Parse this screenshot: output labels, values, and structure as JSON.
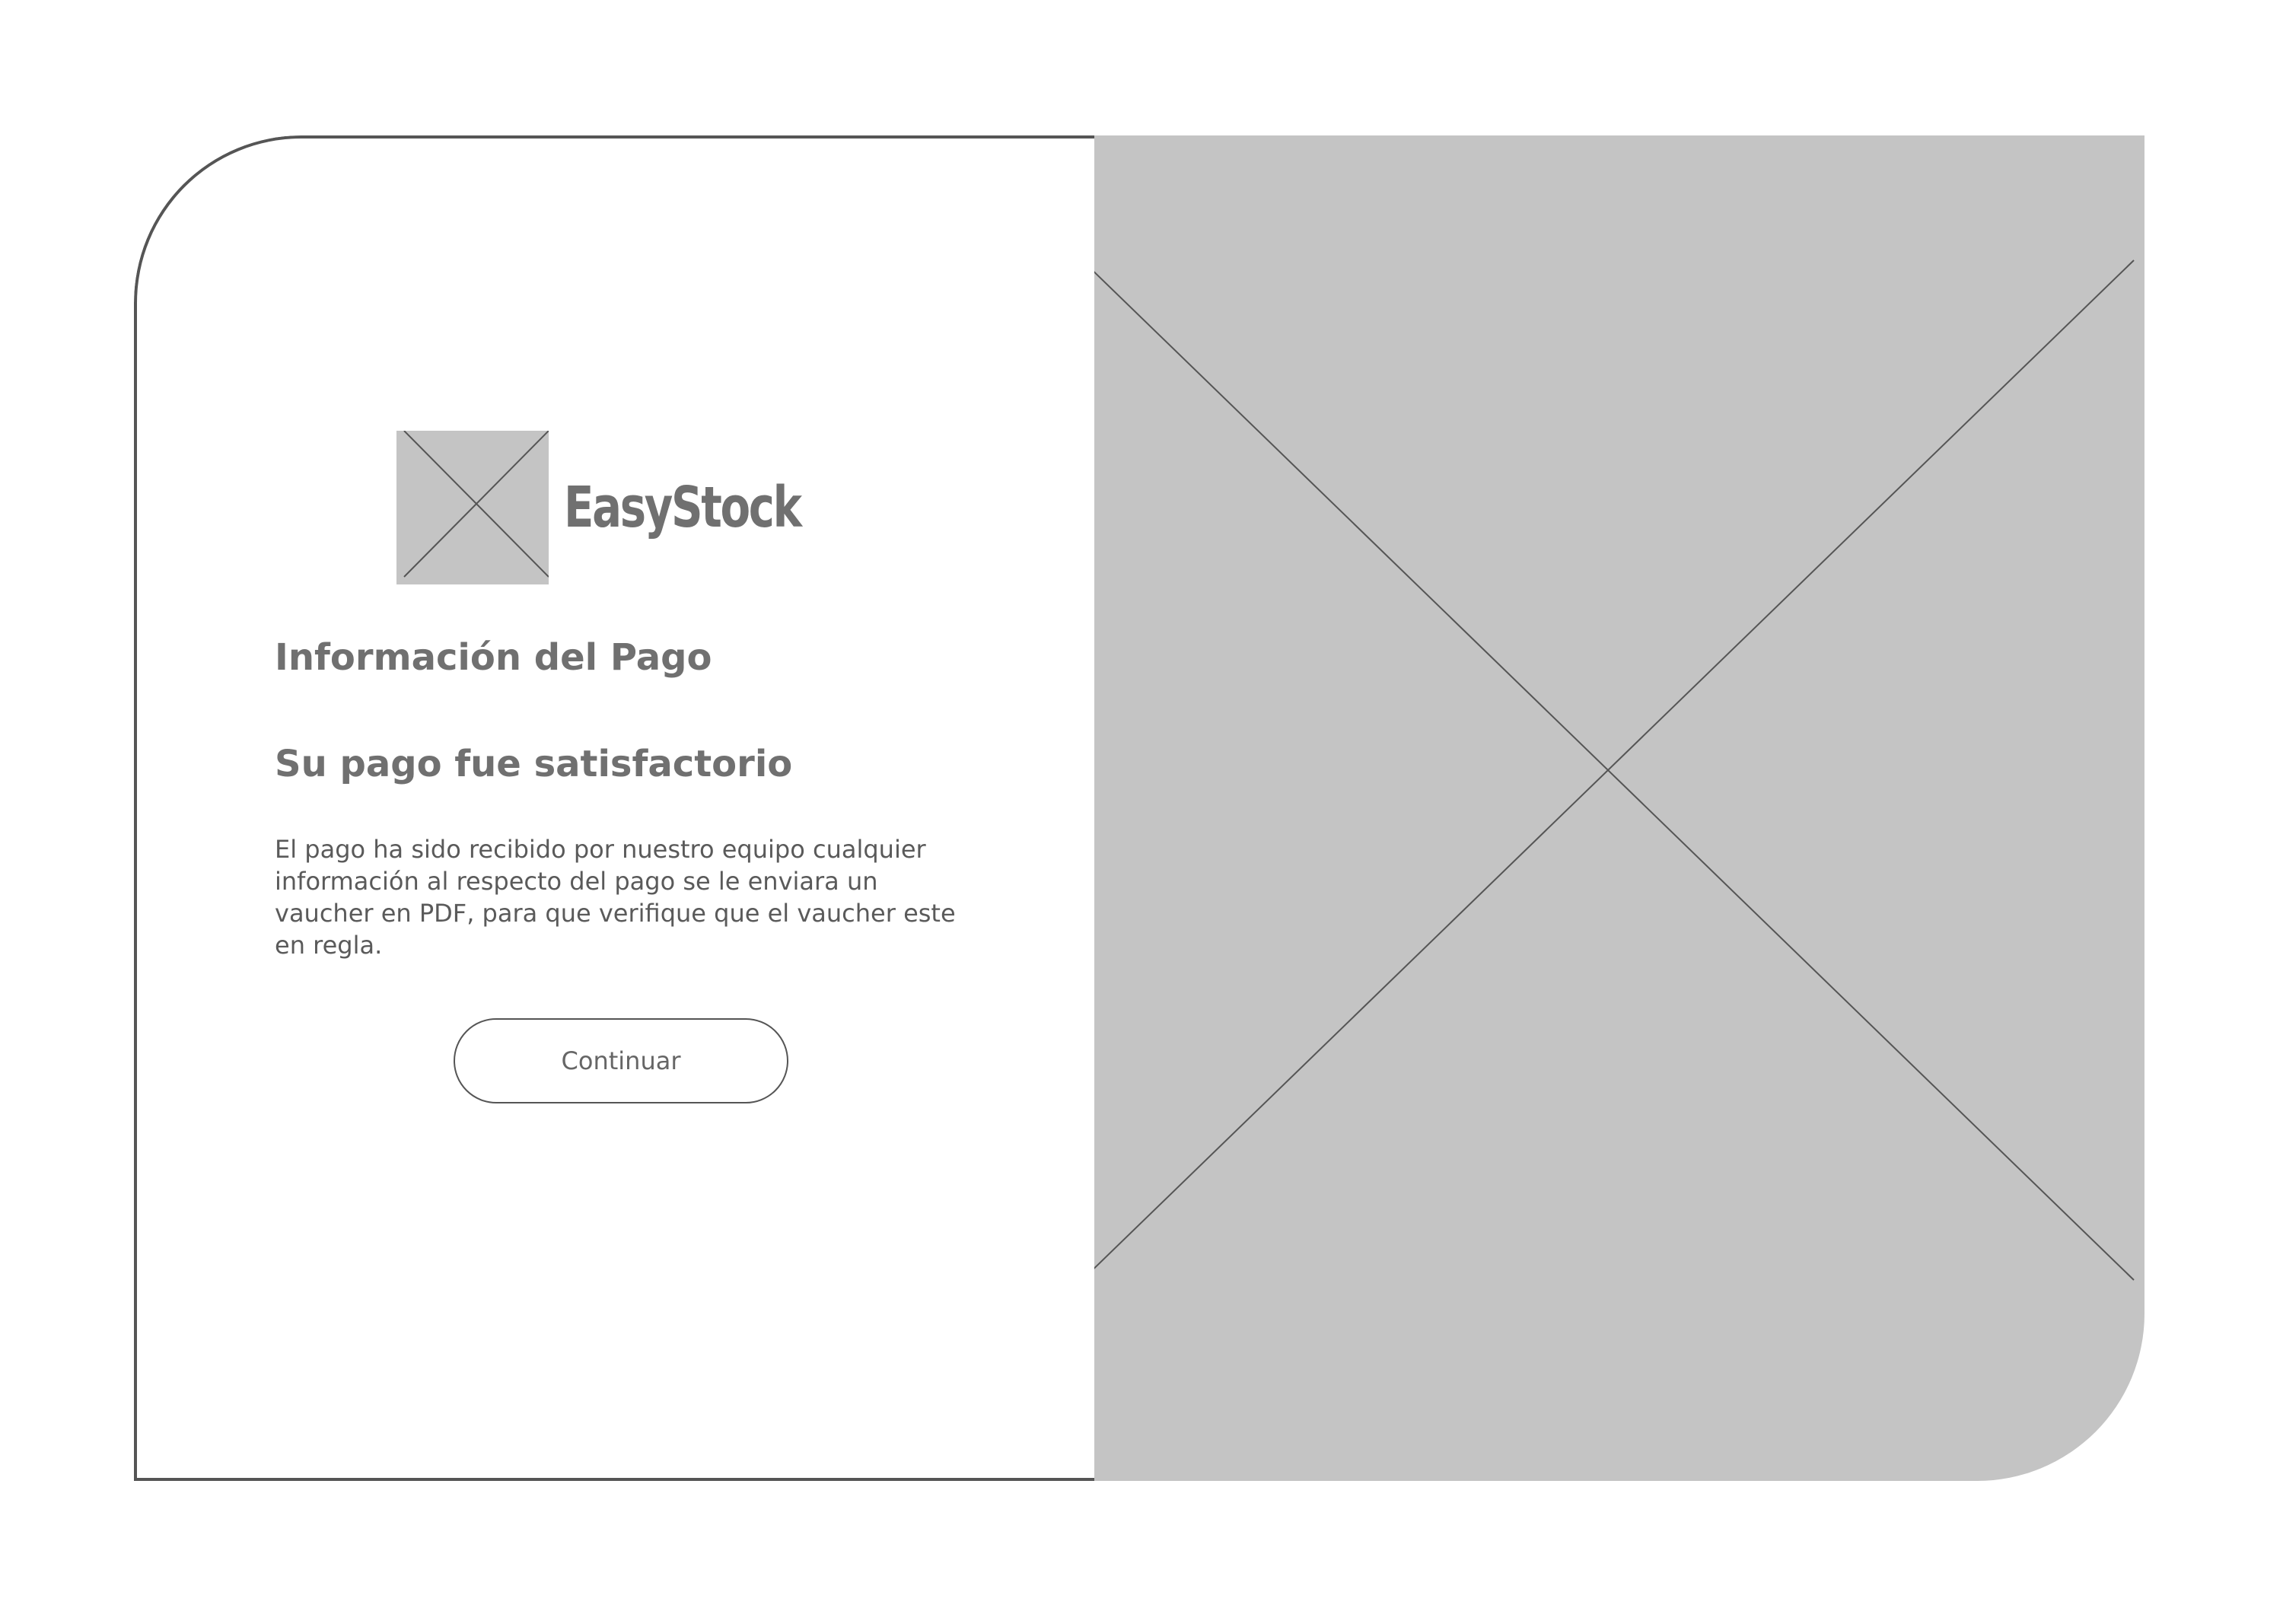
{
  "brand": {
    "name": "EasyStock",
    "logo_icon": "image-placeholder-icon"
  },
  "payment": {
    "title": "Información del Pago",
    "status": "Su pago fue satisfactorio",
    "message": "El pago ha sido recibido por nuestro equipo cualquier información al respecto del pago se le enviara un vaucher en PDF, para que verifique que el vaucher este en regla.",
    "continue_label": "Continuar"
  },
  "hero": {
    "icon": "image-placeholder-icon"
  },
  "colors": {
    "placeholder": "#c4c4c4",
    "text": "#707070",
    "border": "#555555"
  }
}
